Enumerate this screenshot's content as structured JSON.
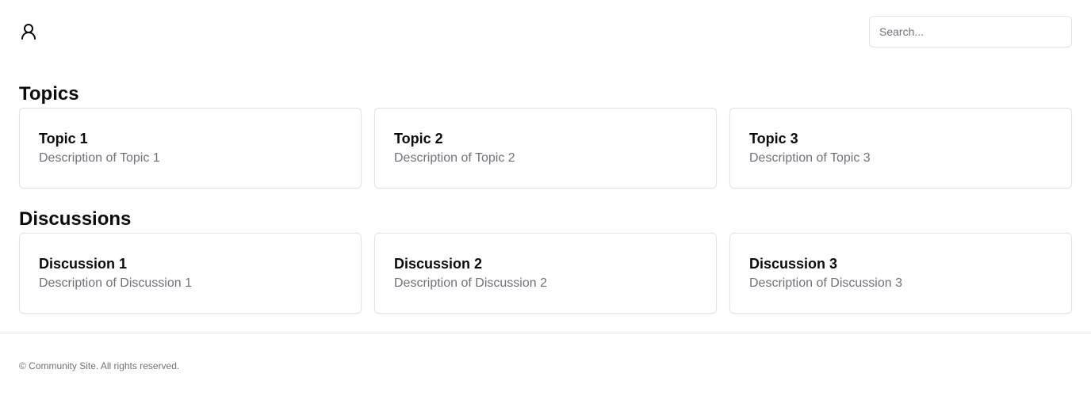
{
  "header": {
    "user_icon": "user-icon",
    "search": {
      "placeholder": "Search...",
      "value": ""
    }
  },
  "topics": {
    "title": "Topics",
    "items": [
      {
        "title": "Topic 1",
        "description": "Description of Topic 1"
      },
      {
        "title": "Topic 2",
        "description": "Description of Topic 2"
      },
      {
        "title": "Topic 3",
        "description": "Description of Topic 3"
      }
    ]
  },
  "discussions": {
    "title": "Discussions",
    "items": [
      {
        "title": "Discussion 1",
        "description": "Description of Discussion 1"
      },
      {
        "title": "Discussion 2",
        "description": "Description of Discussion 2"
      },
      {
        "title": "Discussion 3",
        "description": "Description of Discussion 3"
      }
    ]
  },
  "footer": {
    "text": "© Community Site. All rights reserved."
  },
  "colors": {
    "text": "#0a0a0a",
    "muted": "#71717a",
    "border": "#e4e4e7",
    "background": "#ffffff"
  }
}
